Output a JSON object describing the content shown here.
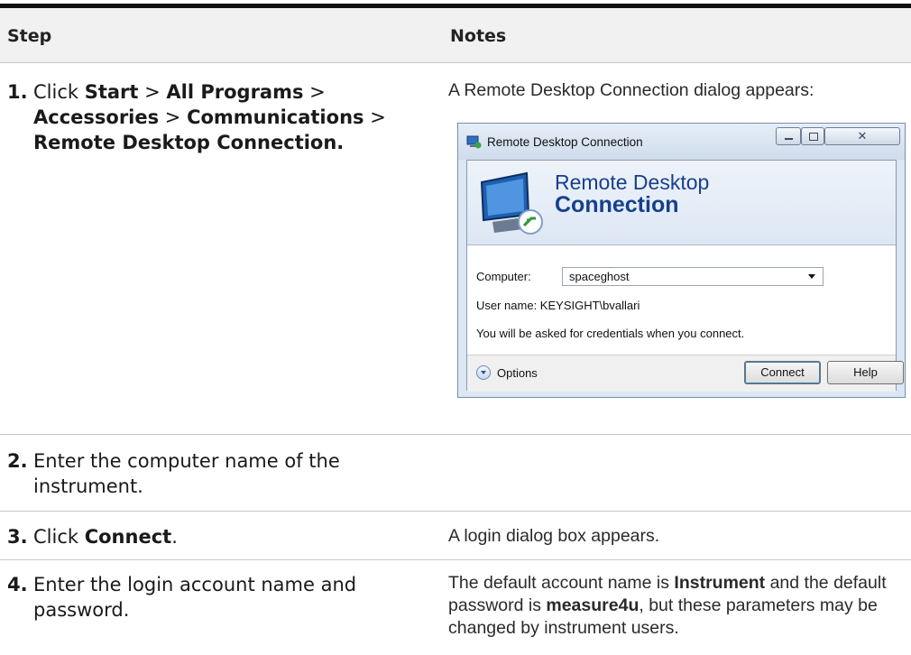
{
  "table": {
    "header_step": "Step",
    "header_notes": "Notes",
    "rows": [
      {
        "num": "1.",
        "step_parts": [
          "Click ",
          "Start",
          " > ",
          "All Programs",
          " > ",
          "Accessories",
          " > ",
          "Communications",
          " > ",
          "Remote Desktop Connection."
        ],
        "note": "A Remote Desktop Connection dialog appears:"
      },
      {
        "num": "2.",
        "step": "Enter the computer name of the instrument."
      },
      {
        "num": "3.",
        "step_parts": [
          "Click ",
          "Connect",
          "."
        ],
        "note": "A login dialog box appears."
      },
      {
        "num": "4.",
        "step": "Enter the login account name and password.",
        "note_parts": [
          "The default account name is ",
          "Instrument",
          " and the default password is ",
          "measure4u",
          ", but these parameters may be changed by instrument users."
        ]
      }
    ]
  },
  "dialog": {
    "title": "Remote Desktop Connection",
    "close_symbol": "✕",
    "banner_line1": "Remote Desktop",
    "banner_line2": "Connection",
    "computer_label": "Computer:",
    "computer_value": "spaceghost",
    "username_line": "User name:  KEYSIGHT\\bvallari",
    "credentials_note": "You will be asked for credentials when you connect.",
    "options_label": "Options",
    "connect_label": "Connect",
    "help_label": "Help",
    "icons": [
      "app-icon",
      "monitor-logo-icon",
      "options-expand-icon"
    ]
  },
  "colors": {
    "banner_text": "#163f8e",
    "dialog_frame": "#dbe7f4",
    "header_bg": "#f1f1f1"
  }
}
